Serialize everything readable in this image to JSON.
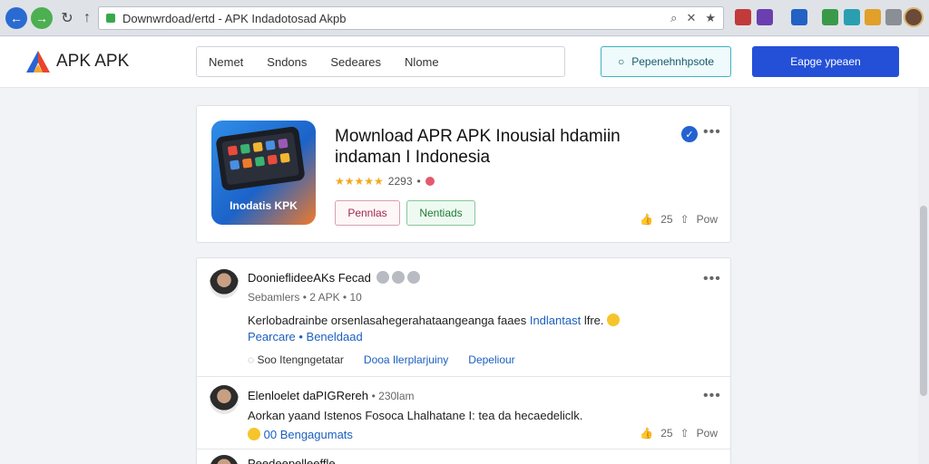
{
  "browser": {
    "url": "Downwrdoad/ertd - APK Indadotosad Akpb",
    "omni_icons": [
      "⌕",
      "✕",
      "★"
    ]
  },
  "site": {
    "logo_text": "APK APK",
    "nav": [
      "Nemet",
      "Sndons",
      "Sedeares",
      "Nlome"
    ],
    "search_button": "Pepenehnhpsote",
    "primary_button": "Eapge ypeaen"
  },
  "app": {
    "title": "Mownload APR APK Inousial hdamiin indaman I Indonesia",
    "thumb_label": "Inodatis KPK",
    "stars": "★★★★★",
    "rating_count": "2293",
    "btn_red": "Pennlas",
    "btn_green": "Nentiads",
    "likes": "25",
    "follow": "Pow"
  },
  "posts": [
    {
      "author": "DoonieflideeAKs Fecad",
      "meta": "Sebamlers • 2 APK • 10",
      "text": "Kerlobadrainbe orsenlasahegerahataangeanga faaes",
      "link": "Indlantast",
      "text_end": "lfre.",
      "tags": "Pearcare • Beneldaad",
      "actions": [
        "Soo Itengngetatar",
        "Dooa Ilerplarjuiny",
        "Depeliour"
      ]
    },
    {
      "author": "Elenloelet daPIGRereh",
      "meta": "• 230lam",
      "text": "Aorkan yaand Istenos Fosoca Lhalhatane I: tea da hecaedeliclk.",
      "tags": "00 Bengagumats",
      "likes": "25",
      "follow": "Pow"
    },
    {
      "author": "Peedeepelleeffle",
      "meta": ""
    }
  ]
}
